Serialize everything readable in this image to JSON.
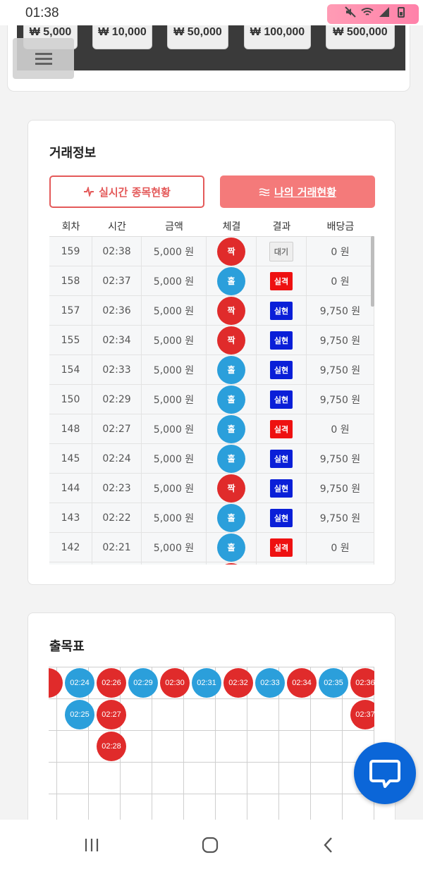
{
  "status": {
    "time": "01:38"
  },
  "amounts": [
    "₩ 5,000",
    "₩ 10,000",
    "₩ 50,000",
    "₩ 100,000",
    "₩ 500,000"
  ],
  "trade": {
    "title": "거래정보",
    "btn_realtime": "실시간 종목현황",
    "btn_mytrade": "나의 거래현황",
    "headers": [
      "회차",
      "시간",
      "금액",
      "체결",
      "결과",
      "배당금"
    ],
    "rows": [
      {
        "round": "159",
        "time": "02:38",
        "amount": "5,000 원",
        "pick": "짝",
        "result": "대기",
        "payout": "0 원"
      },
      {
        "round": "158",
        "time": "02:37",
        "amount": "5,000 원",
        "pick": "홀",
        "result": "실격",
        "payout": "0 원"
      },
      {
        "round": "157",
        "time": "02:36",
        "amount": "5,000 원",
        "pick": "짝",
        "result": "실현",
        "payout": "9,750 원"
      },
      {
        "round": "155",
        "time": "02:34",
        "amount": "5,000 원",
        "pick": "짝",
        "result": "실현",
        "payout": "9,750 원"
      },
      {
        "round": "154",
        "time": "02:33",
        "amount": "5,000 원",
        "pick": "홀",
        "result": "실현",
        "payout": "9,750 원"
      },
      {
        "round": "150",
        "time": "02:29",
        "amount": "5,000 원",
        "pick": "홀",
        "result": "실현",
        "payout": "9,750 원"
      },
      {
        "round": "148",
        "time": "02:27",
        "amount": "5,000 원",
        "pick": "홀",
        "result": "실격",
        "payout": "0 원"
      },
      {
        "round": "145",
        "time": "02:24",
        "amount": "5,000 원",
        "pick": "홀",
        "result": "실현",
        "payout": "9,750 원"
      },
      {
        "round": "144",
        "time": "02:23",
        "amount": "5,000 원",
        "pick": "짝",
        "result": "실현",
        "payout": "9,750 원"
      },
      {
        "round": "143",
        "time": "02:22",
        "amount": "5,000 원",
        "pick": "홀",
        "result": "실현",
        "payout": "9,750 원"
      },
      {
        "round": "142",
        "time": "02:21",
        "amount": "5,000 원",
        "pick": "홀",
        "result": "실격",
        "payout": "0 원"
      }
    ]
  },
  "chart": {
    "title": "출목표",
    "columns": [
      [
        {
          "t": "",
          "c": "red"
        }
      ],
      [
        {
          "t": "02:24",
          "c": "blue"
        },
        {
          "t": "02:25",
          "c": "blue"
        }
      ],
      [
        {
          "t": "02:26",
          "c": "red"
        },
        {
          "t": "02:27",
          "c": "red"
        },
        {
          "t": "02:28",
          "c": "red"
        }
      ],
      [
        {
          "t": "02:29",
          "c": "blue"
        }
      ],
      [
        {
          "t": "02:30",
          "c": "red"
        }
      ],
      [
        {
          "t": "02:31",
          "c": "blue"
        }
      ],
      [
        {
          "t": "02:32",
          "c": "red"
        }
      ],
      [
        {
          "t": "02:33",
          "c": "blue"
        }
      ],
      [
        {
          "t": "02:34",
          "c": "red"
        }
      ],
      [
        {
          "t": "02:35",
          "c": "blue"
        }
      ],
      [
        {
          "t": "02:36",
          "c": "red"
        },
        {
          "t": "02:37",
          "c": "red"
        }
      ]
    ]
  },
  "colors": {
    "odd": "#2b9fdb",
    "even": "#e02b2b",
    "win": "#0a1fd8",
    "lose": "#ee1111",
    "accent": "#f47a7a"
  }
}
